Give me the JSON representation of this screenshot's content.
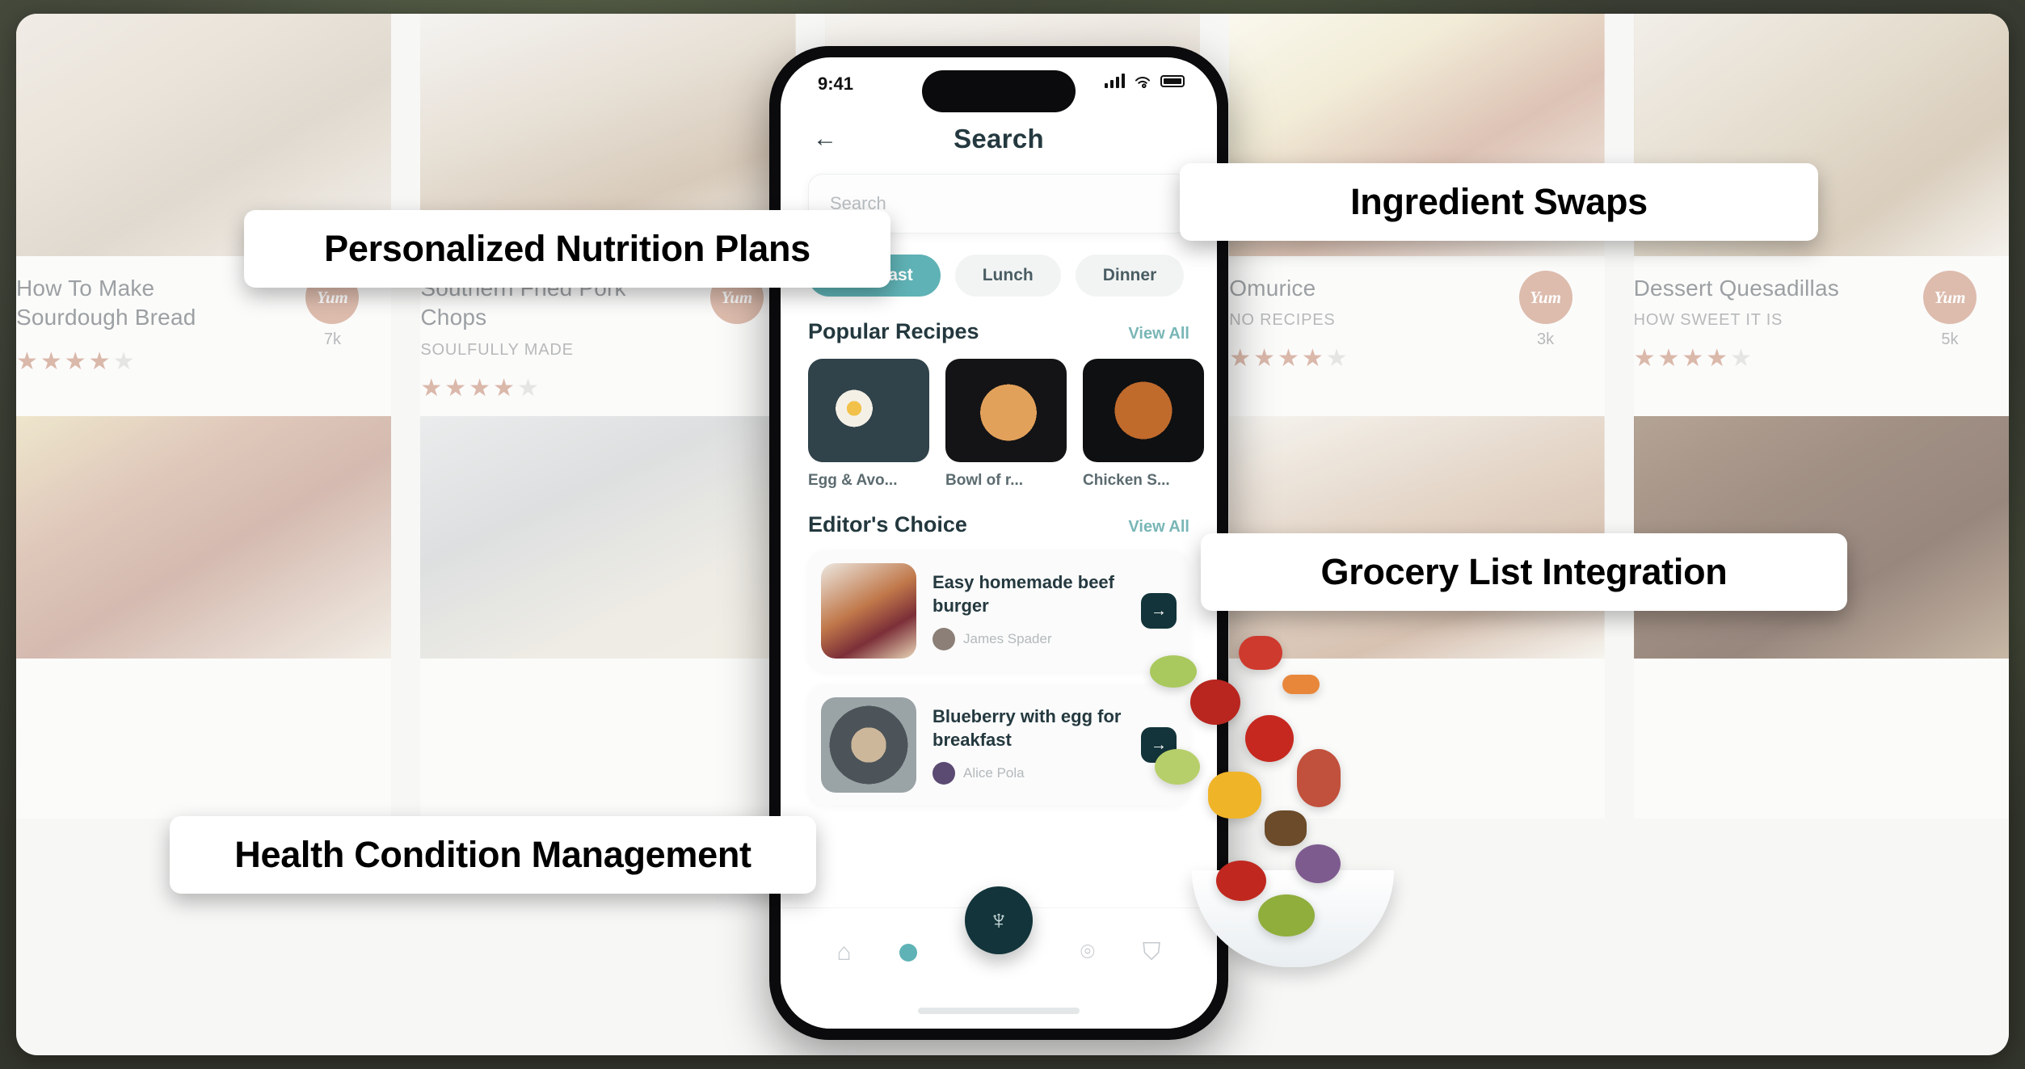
{
  "callouts": [
    {
      "id": "nutrition",
      "label": "Personalized Nutrition Plans"
    },
    {
      "id": "swaps",
      "label": "Ingredient Swaps"
    },
    {
      "id": "grocery",
      "label": "Grocery List Integration"
    },
    {
      "id": "health",
      "label": "Health Condition Management"
    }
  ],
  "phone": {
    "status": {
      "time": "9:41",
      "signal_icon": "signal-bars-icon",
      "wifi_icon": "wifi-icon",
      "battery_icon": "battery-icon"
    },
    "back_icon": "back-arrow-icon",
    "title": "Search",
    "search": {
      "placeholder": "Search",
      "icon": "search-icon"
    },
    "chips": [
      {
        "label": "Breakfast",
        "active": true
      },
      {
        "label": "Lunch",
        "active": false
      },
      {
        "label": "Dinner",
        "active": false
      }
    ],
    "popular": {
      "title": "Popular Recipes",
      "view_all": "View All",
      "cards": [
        {
          "label": "Egg & Avo..."
        },
        {
          "label": "Bowl of r..."
        },
        {
          "label": "Chicken S..."
        }
      ]
    },
    "editors": {
      "title": "Editor's Choice",
      "view_all": "View All",
      "items": [
        {
          "title": "Easy homemade beef burger",
          "author": "James Spader",
          "go_icon": "arrow-right-icon"
        },
        {
          "title": "Blueberry with egg for breakfast",
          "author": "Alice Pola",
          "go_icon": "arrow-right-icon"
        }
      ]
    },
    "tabbar": {
      "items": [
        {
          "icon": "home-icon",
          "active": false
        },
        {
          "icon": "search-dot-icon",
          "active": true
        },
        {
          "icon": "bell-icon",
          "active": false
        },
        {
          "icon": "profile-icon",
          "active": false
        }
      ],
      "fab_icon": "chef-hat-icon"
    }
  },
  "background_grid": {
    "row1": [
      {
        "title": "How To Make Sourdough Bread",
        "source": "",
        "stars": "★★★★",
        "half": "★",
        "yum_label": "Yum",
        "yum_count": "7k",
        "photo": "p-bread"
      },
      {
        "title": "Southern Fried Pork Chops",
        "source": "SOULFULLY MADE",
        "stars": "★★★★",
        "half": "★",
        "yum_label": "Yum",
        "yum_count": "",
        "photo": "p-chops"
      },
      {
        "title": "",
        "source": "",
        "stars": "",
        "half": "",
        "yum_label": "",
        "yum_count": "",
        "photo": "p-center1"
      },
      {
        "title": "Omurice",
        "source": "NO RECIPES",
        "stars": "★★★★",
        "half": "★",
        "yum_label": "Yum",
        "yum_count": "3k",
        "photo": "p-omurice"
      },
      {
        "title": "Dessert Quesadillas",
        "source": "HOW SWEET IT IS",
        "stars": "★★★★",
        "half": "★",
        "yum_label": "Yum",
        "yum_count": "5k",
        "photo": "p-quesa"
      }
    ],
    "row2": [
      {
        "title": "",
        "source": "",
        "stars": "",
        "half": "",
        "yum_label": "",
        "yum_count": "",
        "photo": "p-bacon"
      },
      {
        "title": "",
        "source": "",
        "stars": "",
        "half": "",
        "yum_label": "",
        "yum_count": "",
        "photo": "p-soup"
      },
      {
        "title": "",
        "source": "",
        "stars": "",
        "half": "",
        "yum_label": "",
        "yum_count": "",
        "photo": "p-chicken2"
      },
      {
        "title": "",
        "source": "",
        "stars": "",
        "half": "",
        "yum_label": "",
        "yum_count": "",
        "photo": "p-curry"
      },
      {
        "title": "",
        "source": "",
        "stars": "",
        "half": "",
        "yum_label": "",
        "yum_count": "",
        "photo": "p-wings"
      }
    ]
  },
  "colors": {
    "frame": "#3f4338",
    "accent_teal": "#5fb2b5",
    "dark_teal": "#12343a",
    "yum_peach": "#f3b79c",
    "star": "#f0b39a"
  }
}
